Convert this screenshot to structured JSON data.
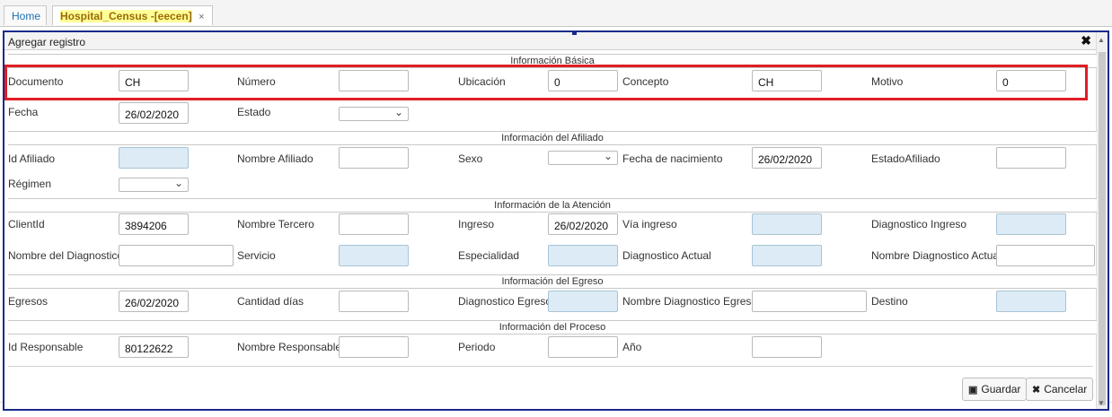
{
  "tabs": {
    "home": "Home",
    "active": "Hospital_Census -[eecen]",
    "close": "×"
  },
  "dialog": {
    "title": "Agregar registro",
    "close": "✖"
  },
  "sections": {
    "basica": "Información Básica",
    "afiliado": "Información del Afiliado",
    "atencion": "Información de la Atención",
    "egreso": "Información del Egreso",
    "proceso": "Información del Proceso"
  },
  "labels": {
    "documento": "Documento",
    "numero": "Número",
    "ubicacion": "Ubicación",
    "concepto": "Concepto",
    "motivo": "Motivo",
    "fecha": "Fecha",
    "estado": "Estado",
    "id_afiliado": "Id Afiliado",
    "nombre_afiliado": "Nombre Afiliado",
    "sexo": "Sexo",
    "fecha_nacimiento": "Fecha de nacimiento",
    "estado_afiliado": "EstadoAfiliado",
    "regimen": "Régimen",
    "client_id": "ClientId",
    "nombre_tercero": "Nombre Tercero",
    "ingreso": "Ingreso",
    "via_ingreso": "Vía ingreso",
    "diagnostico_ingreso": "Diagnostico Ingreso",
    "nombre_diagnostico": "Nombre del Diagnostico",
    "servicio": "Servicio",
    "especialidad": "Especialidad",
    "diagnostico_actual": "Diagnostico Actual",
    "nombre_diagnostico_actual": "Nombre Diagnostico Actual",
    "egresos": "Egresos",
    "cantidad_dias": "Cantidad días",
    "diagnostico_egreso": "Diagnostico Egreso",
    "nombre_diagnostico_egreso": "Nombre Diagnostico Egreso",
    "destino": "Destino",
    "id_responsable": "Id Responsable",
    "nombre_responsable": "Nombre Responsable",
    "periodo": "Periodo",
    "anio": "Año"
  },
  "values": {
    "documento": "CH",
    "numero": "",
    "ubicacion": "0",
    "concepto": "CH",
    "motivo": "0",
    "fecha": "26/02/2020",
    "estado": "",
    "id_afiliado": "",
    "nombre_afiliado": "",
    "sexo": "",
    "fecha_nacimiento": "26/02/2020",
    "estado_afiliado": "",
    "regimen": "",
    "client_id": "3894206",
    "nombre_tercero": "",
    "ingreso": "26/02/2020",
    "via_ingreso": "",
    "diagnostico_ingreso": "",
    "nombre_diagnostico": "",
    "servicio": "",
    "especialidad": "",
    "diagnostico_actual": "",
    "nombre_diagnostico_actual": "",
    "egresos": "26/02/2020",
    "cantidad_dias": "",
    "diagnostico_egreso": "",
    "nombre_diagnostico_egreso": "",
    "destino": "",
    "id_responsable": "80122622",
    "nombre_responsable": "",
    "periodo": "",
    "anio": ""
  },
  "buttons": {
    "guardar": "Guardar",
    "cancelar": "Cancelar"
  },
  "colors": {
    "highlight_box": "#e01e25",
    "readonly_input": "#dcebf5",
    "dialog_border": "#1a2a8a"
  }
}
